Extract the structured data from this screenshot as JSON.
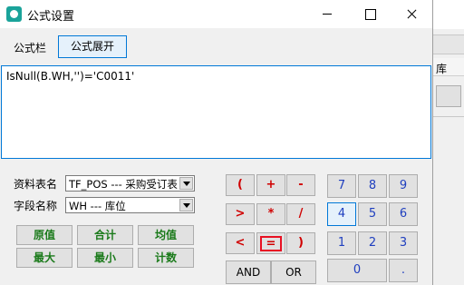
{
  "window": {
    "title": "公式设置"
  },
  "toolbar": {
    "label": "公式栏",
    "expand_button": "公式展开"
  },
  "formula": {
    "text": "IsNull(B.WH,'')='C0011'"
  },
  "fields": {
    "table_label": "资料表名",
    "table_value": "TF_POS --- 采购受订表",
    "field_label": "字段名称",
    "field_value": "WH --- 库位"
  },
  "functions": {
    "original": "原值",
    "sum": "合计",
    "avg": "均值",
    "max": "最大",
    "min": "最小",
    "count": "计数"
  },
  "operators": {
    "lparen": "(",
    "plus": "+",
    "minus": "-",
    "gt": ">",
    "times": "*",
    "divide": "/",
    "lt": "<",
    "eq": "=",
    "rparen": ")",
    "and": "AND",
    "or": "OR"
  },
  "numpad": {
    "n7": "7",
    "n8": "8",
    "n9": "9",
    "n4": "4",
    "n5": "5",
    "n6": "6",
    "n1": "1",
    "n2": "2",
    "n3": "3",
    "n0": "0",
    "dot": "."
  },
  "background_window": {
    "header_text": "库"
  },
  "colors": {
    "function_text": "#1a7a1a",
    "operator_text": "#d00000",
    "number_text": "#1f3fbf",
    "focus_border": "#0078d7",
    "highlight_border": "#e81123"
  }
}
